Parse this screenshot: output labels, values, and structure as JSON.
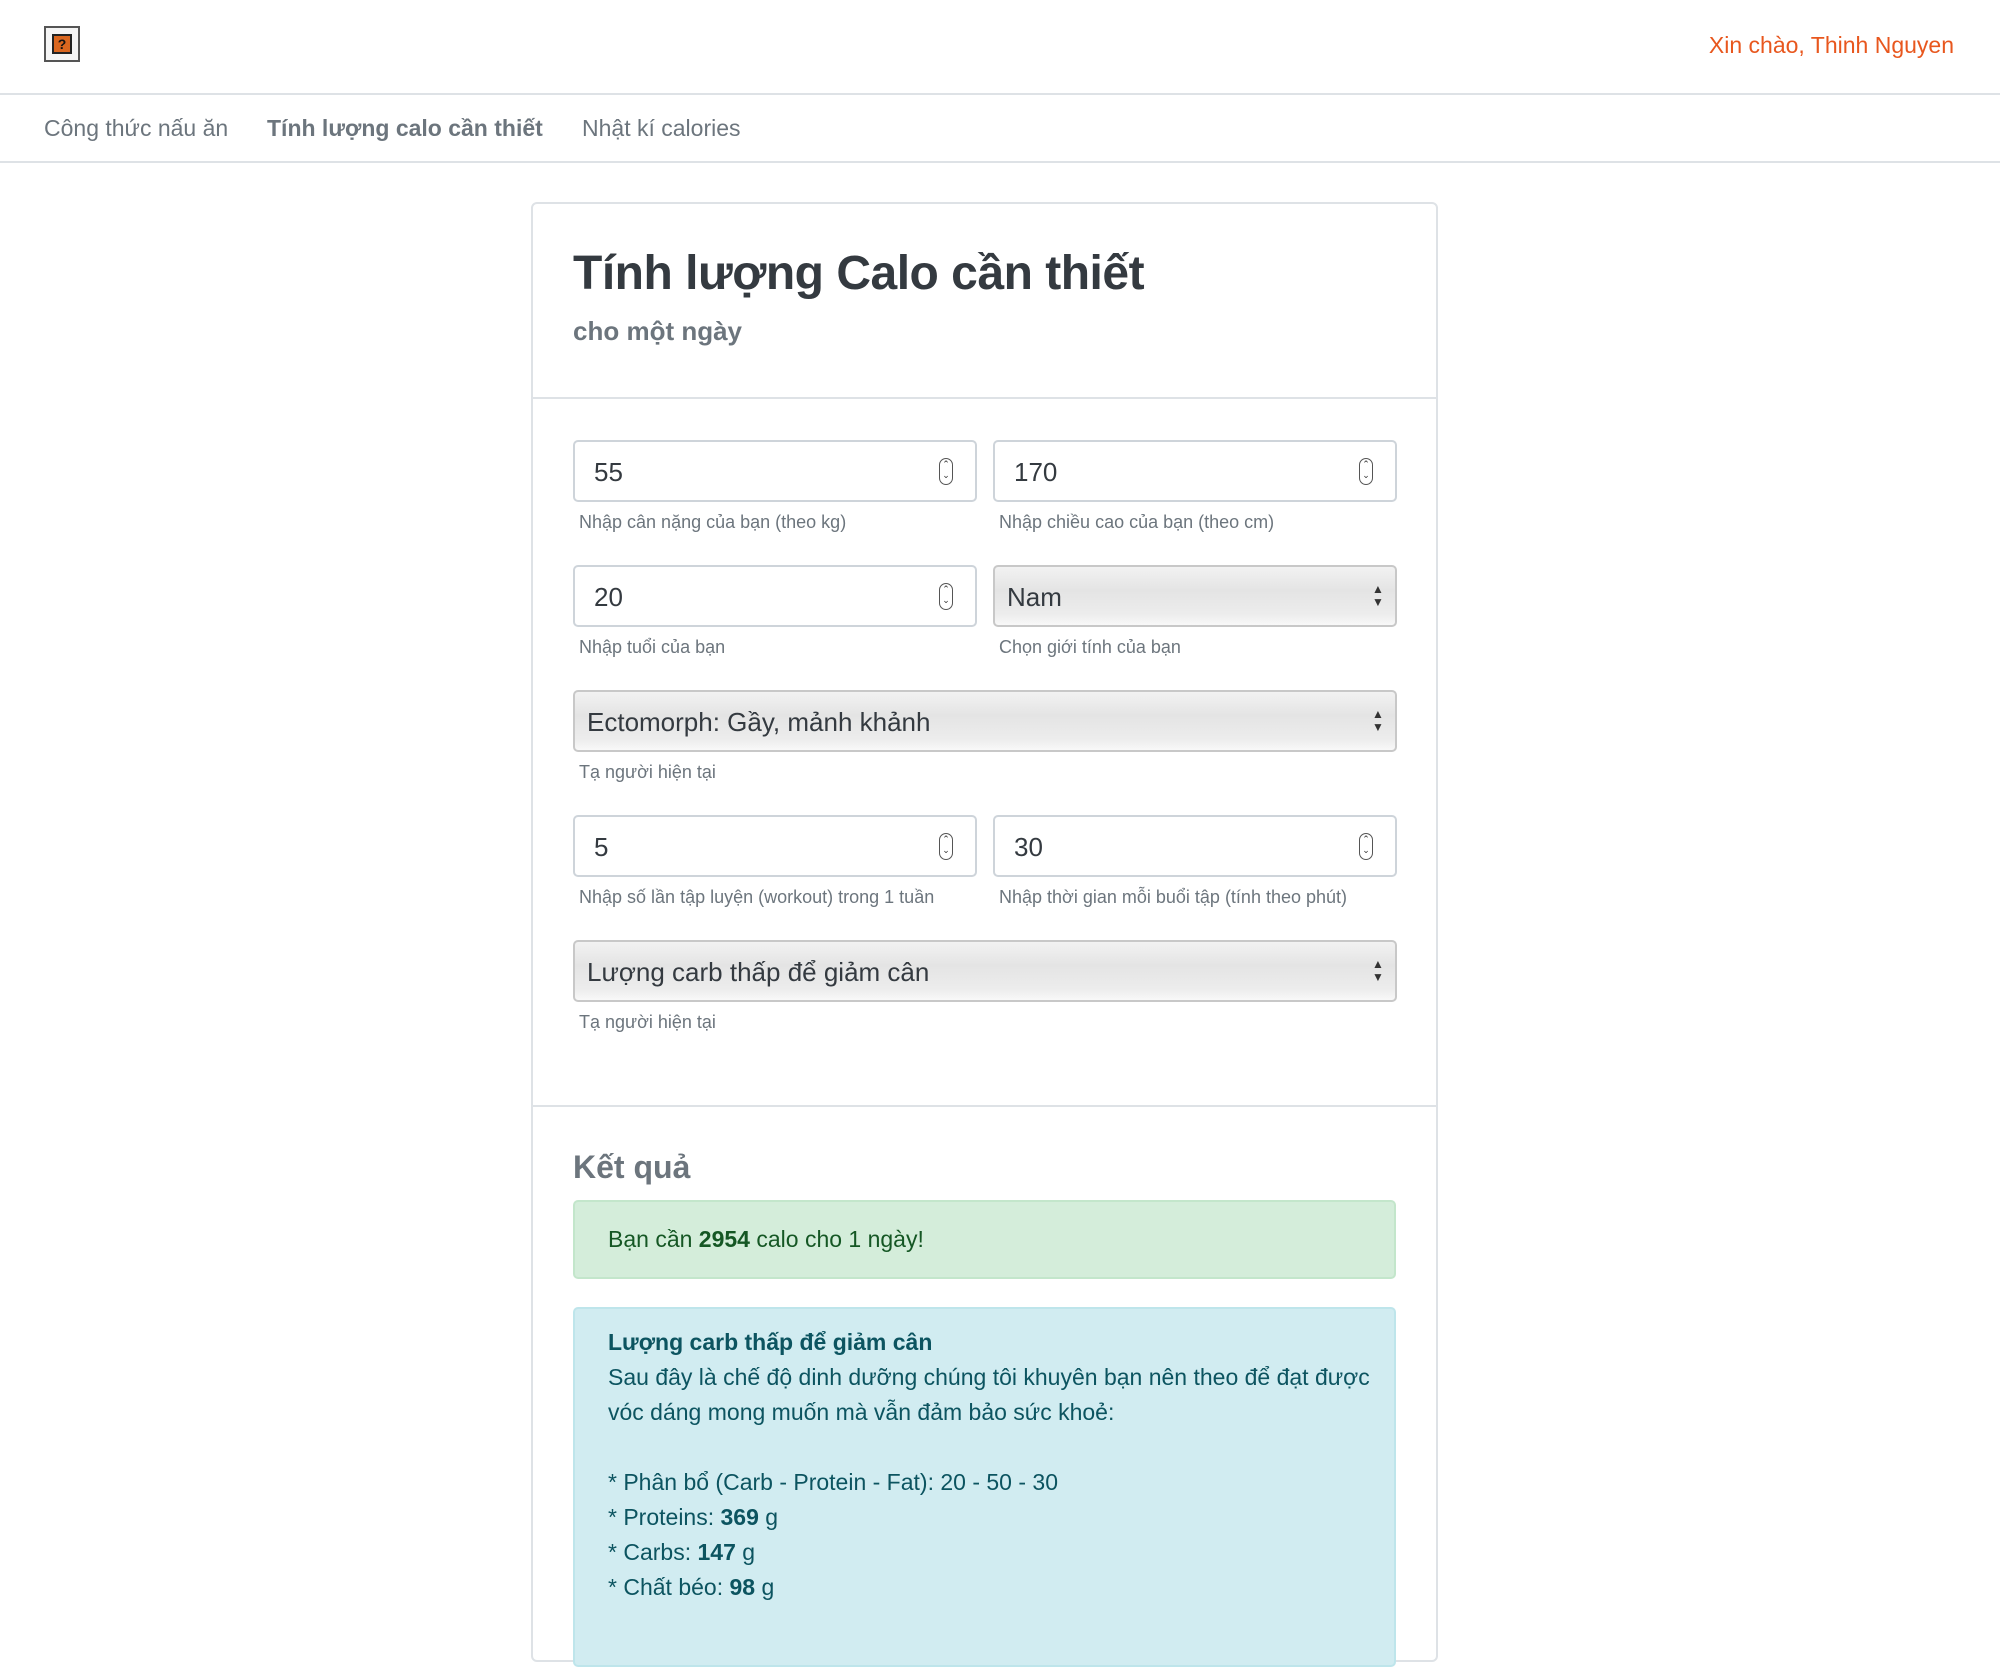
{
  "header": {
    "logo_icon": "broken-image-icon",
    "logo_glyph": "?",
    "greeting": "Xin chào, Thinh Nguyen"
  },
  "nav": {
    "items": [
      {
        "label": "Công thức nấu ăn"
      },
      {
        "label": "Tính lượng calo cần thiết",
        "active": true
      },
      {
        "label": "Nhật kí calories"
      }
    ]
  },
  "card": {
    "title": "Tính lượng Calo cần thiết",
    "subtitle": "cho một ngày"
  },
  "form": {
    "weight": {
      "value": "55",
      "help": "Nhập cân nặng của bạn (theo kg)"
    },
    "height": {
      "value": "170",
      "help": "Nhập chiều cao của bạn (theo cm)"
    },
    "age": {
      "value": "20",
      "help": "Nhập tuổi của bạn"
    },
    "gender": {
      "value": "Nam",
      "help": "Chọn giới tính của bạn"
    },
    "body_type": {
      "value": "Ectomorph: Gầy, mảnh khảnh",
      "help": "Tạ người hiện tại"
    },
    "workouts": {
      "value": "5",
      "help": "Nhập số lần tập luyện (workout) trong 1 tuần"
    },
    "duration": {
      "value": "30",
      "help": "Nhập thời gian mỗi buổi tập (tính theo phút)"
    },
    "diet_plan": {
      "value": "Lượng carb thấp để giảm cân",
      "help": "Tạ người hiện tại"
    }
  },
  "results": {
    "title": "Kết quả",
    "calories_prefix": "Bạn cần",
    "calories_value": "2954",
    "calories_suffix": "calo cho 1 ngày!",
    "plan_title": "Lượng carb thấp để giảm cân",
    "plan_intro": "Sau đây là chế độ dinh dưỡng chúng tôi khuyên bạn nên theo để đạt được vóc dáng mong muốn mà vẫn đảm bảo sức khoẻ:",
    "distribution": "* Phân bổ (Carb - Protein - Fat): 20 - 50 - 30",
    "proteins_label": "* Proteins:",
    "proteins_value": "369",
    "carbs_label": "* Carbs:",
    "carbs_value": "147",
    "fat_label": "* Chất béo:",
    "fat_value": "98",
    "unit": "g"
  },
  "colors": {
    "accent": "#e8571e",
    "success_bg": "#d4edda",
    "info_bg": "#d1ecf1"
  }
}
